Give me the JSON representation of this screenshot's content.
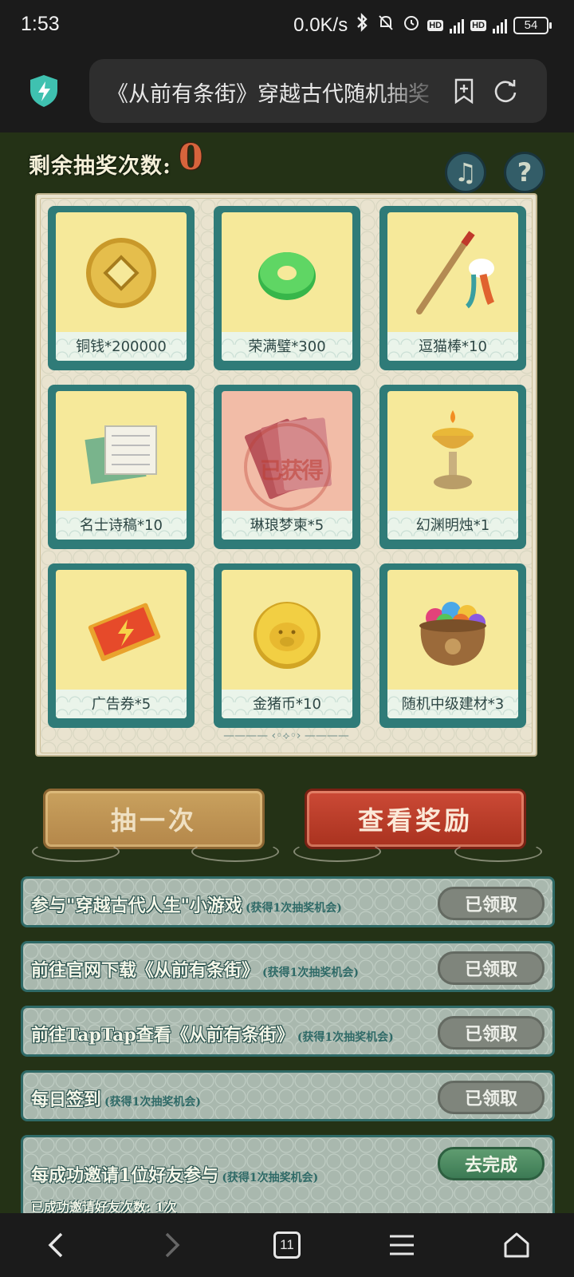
{
  "status_bar": {
    "time": "1:53",
    "net_speed": "0.0K/s",
    "signal_tag": "4G",
    "hd_tag": "HD",
    "battery": "54"
  },
  "browser": {
    "url_title": "《从前有条街》穿越古代随机抽奖",
    "icons": [
      "shield-icon",
      "bookmark-add-icon",
      "refresh-icon"
    ]
  },
  "game": {
    "remaining_label": "剩余抽奖次数:",
    "remaining_value": "0",
    "music_icon": "♫",
    "help_icon": "?",
    "prizes": [
      {
        "label": "铜钱*200000",
        "icon": "copper-coin-icon",
        "claimed": false
      },
      {
        "label": "荣满璧*300",
        "icon": "jade-disc-icon",
        "claimed": false
      },
      {
        "label": "逗猫棒*10",
        "icon": "cat-teaser-icon",
        "claimed": false
      },
      {
        "label": "名士诗稿*10",
        "icon": "scroll-icon",
        "claimed": false
      },
      {
        "label": "琳琅梦柬*5",
        "icon": "invitation-cards-icon",
        "claimed": true,
        "stamp": "已获得"
      },
      {
        "label": "幻渊明烛*1",
        "icon": "candle-icon",
        "claimed": false
      },
      {
        "label": "广告券*5",
        "icon": "ad-ticket-icon",
        "claimed": false
      },
      {
        "label": "金猪币*10",
        "icon": "gold-pig-coin-icon",
        "claimed": false
      },
      {
        "label": "随机中级建材*3",
        "icon": "treasure-pot-icon",
        "claimed": false
      }
    ],
    "draw_button": "抽一次",
    "view_button": "查看奖励",
    "tasks": [
      {
        "title": "参与\"穿越古代人生\"小游戏",
        "hint": "(获得1次抽奖机会)",
        "button": "已领取",
        "state": "done"
      },
      {
        "title": "前往官网下载《从前有条街》",
        "hint": "(获得1次抽奖机会)",
        "button": "已领取",
        "state": "done"
      },
      {
        "title": "前往TapTap查看《从前有条街》",
        "hint": "(获得1次抽奖机会)",
        "button": "已领取",
        "state": "done"
      },
      {
        "title": "每日签到",
        "hint": "(获得1次抽奖机会)",
        "button": "已领取",
        "state": "done"
      },
      {
        "title": "每成功邀请1位好友参与",
        "hint": "(获得1次抽奖机会)",
        "button": "去完成",
        "state": "todo",
        "sub": "已成功邀请好友次数: 1次"
      }
    ]
  },
  "nav": {
    "tab_count": "11",
    "items": [
      "back-icon",
      "forward-icon",
      "tabs-icon",
      "menu-icon",
      "home-icon"
    ]
  }
}
